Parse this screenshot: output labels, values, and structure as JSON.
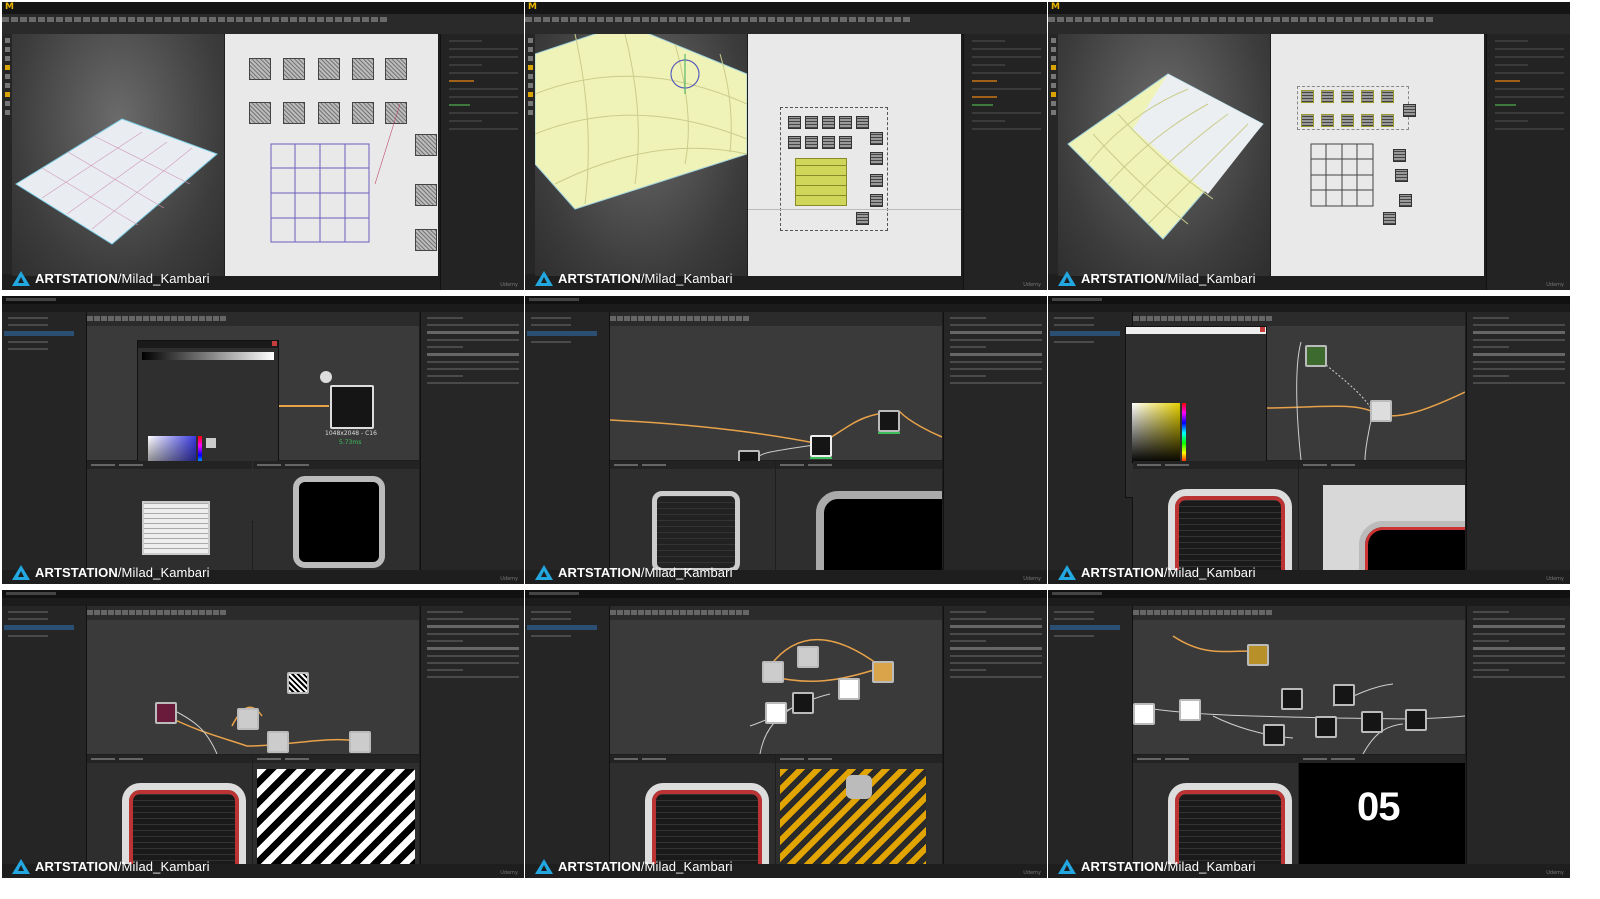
{
  "watermark": {
    "brand": "ARTSTATION",
    "handle": "/Milad_Kambari"
  },
  "panels": [
    {
      "id": "p1",
      "app": "RizomUV",
      "credit": "Udemy"
    },
    {
      "id": "p2",
      "app": "RizomUV",
      "credit": "Udemy"
    },
    {
      "id": "p3",
      "app": "RizomUV",
      "credit": "Udemy"
    },
    {
      "id": "p4",
      "app": "Substance Designer",
      "credit": "Udemy",
      "node_resolution": "1048x2048 - C16",
      "node_timing": "5.73ms"
    },
    {
      "id": "p5",
      "app": "Substance Designer",
      "credit": "Udemy"
    },
    {
      "id": "p6",
      "app": "Substance Designer",
      "credit": "Udemy"
    },
    {
      "id": "p7",
      "app": "Substance Designer",
      "credit": "Udemy"
    },
    {
      "id": "p8",
      "app": "Substance Designer",
      "credit": "Udemy"
    },
    {
      "id": "p9",
      "app": "Substance Designer",
      "credit": "Udemy",
      "overlay_number": "05"
    }
  ],
  "colors": {
    "artstation_blue": "#22a7e0",
    "node_wire_orange": "#e8a24a",
    "uv_selection_yellow": "#cfd65a",
    "ui_dark": "#1e1e1e"
  }
}
